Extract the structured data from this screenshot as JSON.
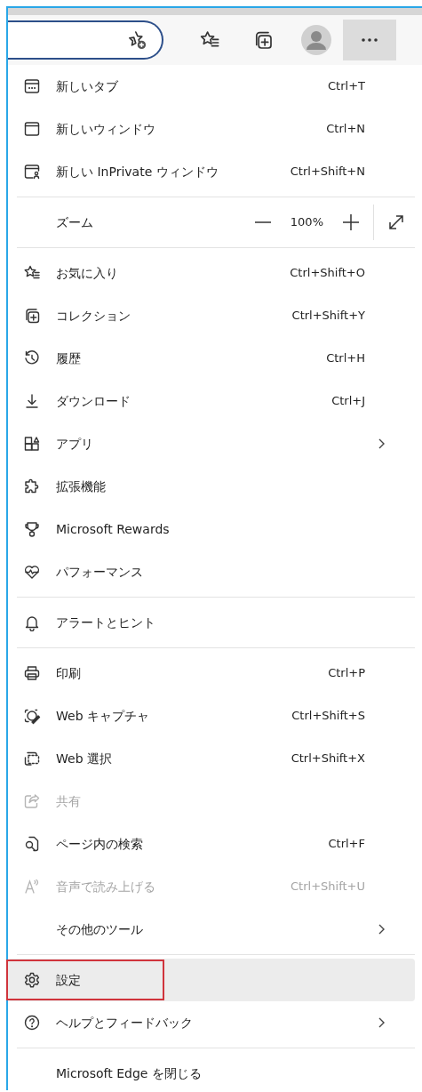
{
  "toolbar": {
    "more_button": {
      "selected": true
    }
  },
  "menu": {
    "sections": [
      {
        "kind": "items",
        "items": [
          {
            "label": "新しいタブ",
            "shortcut": "Ctrl+T",
            "submenu": false,
            "disabled": false,
            "selected": false
          },
          {
            "label": "新しいウィンドウ",
            "shortcut": "Ctrl+N",
            "submenu": false,
            "disabled": false,
            "selected": false
          },
          {
            "label": "新しい InPrivate ウィンドウ",
            "shortcut": "Ctrl+Shift+N",
            "submenu": false,
            "disabled": false,
            "selected": false
          }
        ]
      },
      {
        "kind": "zoom",
        "label": "ズーム",
        "value": "100%"
      },
      {
        "kind": "items",
        "items": [
          {
            "label": "お気に入り",
            "shortcut": "Ctrl+Shift+O",
            "submenu": false,
            "disabled": false,
            "selected": false
          },
          {
            "label": "コレクション",
            "shortcut": "Ctrl+Shift+Y",
            "submenu": false,
            "disabled": false,
            "selected": false
          },
          {
            "label": "履歴",
            "shortcut": "Ctrl+H",
            "submenu": false,
            "disabled": false,
            "selected": false
          },
          {
            "label": "ダウンロード",
            "shortcut": "Ctrl+J",
            "submenu": false,
            "disabled": false,
            "selected": false
          },
          {
            "label": "アプリ",
            "submenu": true,
            "disabled": false,
            "selected": false
          },
          {
            "label": "拡張機能",
            "submenu": false,
            "disabled": false,
            "selected": false
          },
          {
            "label": "Microsoft Rewards",
            "submenu": false,
            "disabled": false,
            "selected": false
          },
          {
            "label": "パフォーマンス",
            "submenu": false,
            "disabled": false,
            "selected": false
          }
        ]
      },
      {
        "kind": "items",
        "items": [
          {
            "label": "アラートとヒント",
            "submenu": false,
            "disabled": false,
            "selected": false
          }
        ]
      },
      {
        "kind": "items",
        "items": [
          {
            "label": "印刷",
            "shortcut": "Ctrl+P",
            "submenu": false,
            "disabled": false,
            "selected": false
          },
          {
            "label": "Web キャプチャ",
            "shortcut": "Ctrl+Shift+S",
            "submenu": false,
            "disabled": false,
            "selected": false
          },
          {
            "label": "Web 選択",
            "shortcut": "Ctrl+Shift+X",
            "submenu": false,
            "disabled": false,
            "selected": false
          },
          {
            "label": "共有",
            "submenu": false,
            "disabled": true,
            "selected": false
          },
          {
            "label": "ページ内の検索",
            "shortcut": "Ctrl+F",
            "submenu": false,
            "disabled": false,
            "selected": false
          },
          {
            "label": "音声で読み上げる",
            "shortcut": "Ctrl+Shift+U",
            "submenu": false,
            "disabled": true,
            "selected": false
          },
          {
            "label": "その他のツール",
            "submenu": true,
            "disabled": false,
            "selected": false
          }
        ]
      },
      {
        "kind": "items",
        "items": [
          {
            "label": "設定",
            "submenu": false,
            "disabled": false,
            "selected": true,
            "outlined": true
          },
          {
            "label": "ヘルプとフィードバック",
            "submenu": true,
            "disabled": false,
            "selected": false
          }
        ]
      },
      {
        "kind": "items",
        "items": [
          {
            "label": "Microsoft Edge を閉じる",
            "submenu": false,
            "disabled": false,
            "selected": false
          }
        ]
      }
    ]
  }
}
